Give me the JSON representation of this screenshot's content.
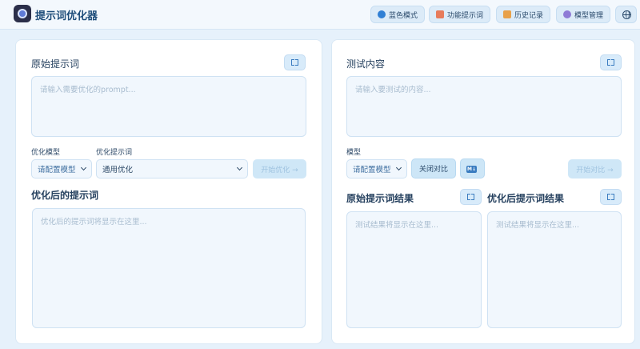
{
  "header": {
    "title": "提示词优化器",
    "buttons": {
      "theme": "蓝色模式",
      "templates": "功能提示词",
      "history": "历史记录",
      "models": "模型管理"
    }
  },
  "left": {
    "original_title": "原始提示词",
    "original_placeholder": "请输入需要优化的prompt...",
    "model_label": "优化模型",
    "model_value": "请配置模型",
    "template_label": "优化提示词",
    "template_value": "通用优化",
    "optimize_button": "开始优化 →",
    "result_title": "优化后的提示词",
    "result_placeholder": "优化后的提示词将显示在这里..."
  },
  "right": {
    "test_title": "测试内容",
    "test_placeholder": "请输入要测试的内容...",
    "model_label": "模型",
    "model_value": "请配置模型",
    "compare_toggle": "关闭对比",
    "markdown_badge": "M↓",
    "test_button": "开始对比 →",
    "original_result_title": "原始提示词结果",
    "optimized_result_title": "优化后提示词结果",
    "result_placeholder": "测试结果将显示在这里..."
  },
  "colors": {
    "background": "#e6f1fb",
    "accent": "#3a7cc0",
    "disabled_button": "#cfe7f7"
  }
}
